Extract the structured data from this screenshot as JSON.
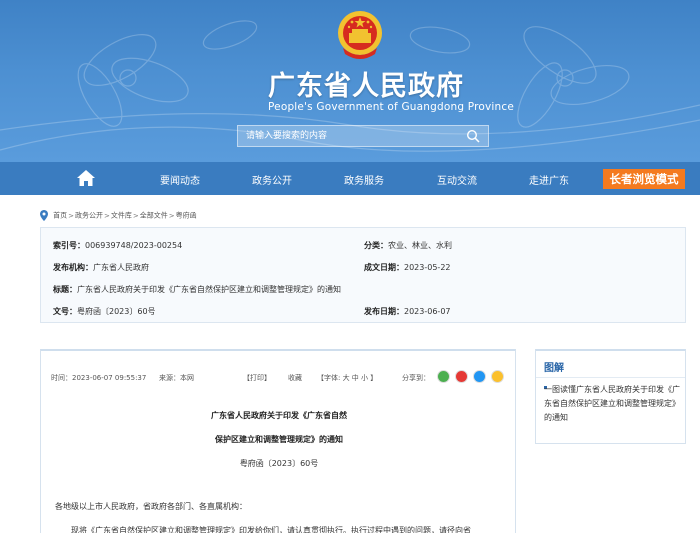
{
  "header": {
    "title": "广东省人民政府",
    "subtitle": "People's Government of Guangdong Province",
    "search_placeholder": "请输入要搜索的内容"
  },
  "nav": {
    "items": [
      "要闻动态",
      "政务公开",
      "政务服务",
      "互动交流",
      "走进广东"
    ],
    "elder_mode": "长者浏览模式"
  },
  "breadcrumb": [
    "首页",
    "政务公开",
    "文件库",
    "全部文件",
    "粤府函"
  ],
  "info": {
    "index_label": "索引号：",
    "index_value": "006939748/2023-00254",
    "category_label": "分类：",
    "category_value": "农业、林业、水利",
    "issuer_label": "发布机构：",
    "issuer_value": "广东省人民政府",
    "created_label": "成文日期：",
    "created_value": "2023-05-22",
    "title_label": "标题：",
    "title_value": "广东省人民政府关于印发《广东省自然保护区建立和调整管理规定》的通知",
    "docno_label": "文号：",
    "docno_value": "粤府函〔2023〕60号",
    "published_label": "发布日期：",
    "published_value": "2023-06-07"
  },
  "article": {
    "time": "时间：2023-06-07 09:55:37",
    "source": "来源：本网",
    "print": "【打印】",
    "favorite": "收藏",
    "font_size": "【字体: 大   中   小 】",
    "share": "分享到：",
    "title_line1": "广东省人民政府关于印发《广东省自然",
    "title_line2": "保护区建立和调整管理规定》的通知",
    "doc_number": "粤府函〔2023〕60号",
    "para1": "各地级以上市人民政府，省政府各部门、各直属机构：",
    "para2": "现将《广东省自然保护区建立和调整管理规定》印发给你们，请认真贯彻执行。执行过程中遇到的问题，请径向省"
  },
  "sidebar": {
    "title": "图解",
    "link": "一图读懂广东省人民政府关于印发《广东省自然保护区建立和调整管理规定》的通知"
  },
  "colors": {
    "banner": "#4a8dd0",
    "nav": "#3a7cc0",
    "elder_button": "#f47a1f",
    "share_wechat": "#4caf50",
    "share_weibo": "#e53935",
    "share_qq": "#2196f3",
    "share_qzone": "#fbc02d"
  }
}
